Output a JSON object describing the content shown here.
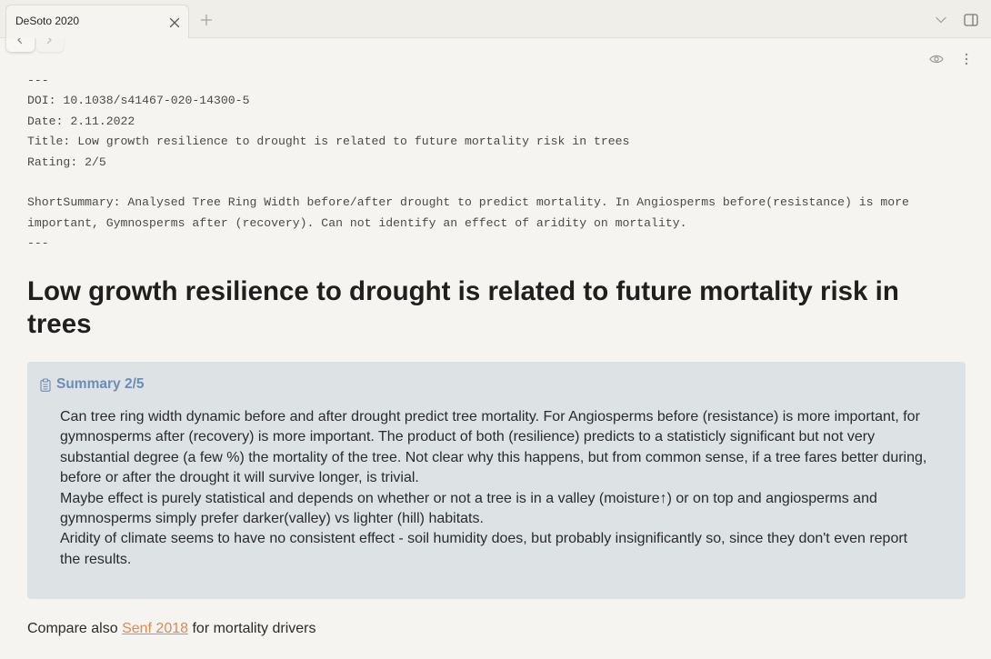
{
  "theme": {
    "background": "#f5f4f0",
    "callout_background": "#dde2e5",
    "callout_title_color": "#6b8db6",
    "link_color": "#e0894e"
  },
  "tabs": [
    {
      "title": "DeSoto 2020",
      "active": true,
      "close_icon": "close-icon"
    }
  ],
  "tab_bar": {
    "new_tab_icon": "plus-icon",
    "tab_list_icon": "chevron-down-icon",
    "sidebar_toggle_icon": "sidebar-right-icon"
  },
  "view_header": {
    "back_icon": "chevron-left-icon",
    "forward_icon": "chevron-right-icon",
    "reading_view_icon": "eye-icon",
    "more_options_icon": "more-vertical-icon"
  },
  "frontmatter": {
    "open": "---",
    "fields": [
      "DOI: 10.1038/s41467-020-14300-5",
      "Date: 2.11.2022",
      "Title: Low growth resilience to drought is related to future mortality risk in trees",
      "Rating: 2/5"
    ],
    "short_summary": "ShortSummary: Analysed Tree Ring Width before/after drought to predict mortality. In Angiosperms before(resistance) is more important, Gymnosperms after (recovery). Can not identify an effect of aridity on mortality.",
    "close": "---"
  },
  "heading": "Low growth resilience to drought is related to future mortality risk in trees",
  "callout": {
    "icon": "clipboard-list-icon",
    "title": "Summary 2/5",
    "paragraphs": [
      {
        "lines": [
          "Can tree ring width dynamic before and after drought predict tree mortality. For Angiosperms before (resistance) is more important, for",
          "gymnosperms after (recovery) is more important. The product of both (resilience) predicts to a statisticly significant but not very",
          "substantial degree (a few %) the mortality of the tree. Not clear why this happens, but from common sense, if a tree fares better during,",
          "before or after the drought it will survive longer, is trivial."
        ]
      },
      {
        "lines": [
          "Maybe effect is purely statistical and depends on whether or not a tree is in a valley (moisture↑) or on top and angiosperms and",
          "gymnosperms simply prefer darker(valley) vs lighter (hill) habitats."
        ]
      },
      {
        "lines": [
          "Aridity of climate seems to have no consistent effect - soil humidity does, but probably insignificantly so, since they don't even report",
          "the results."
        ]
      }
    ]
  },
  "footer": {
    "prefix": "Compare also",
    "link_text": "Senf 2018",
    "suffix": "for mortality drivers"
  }
}
